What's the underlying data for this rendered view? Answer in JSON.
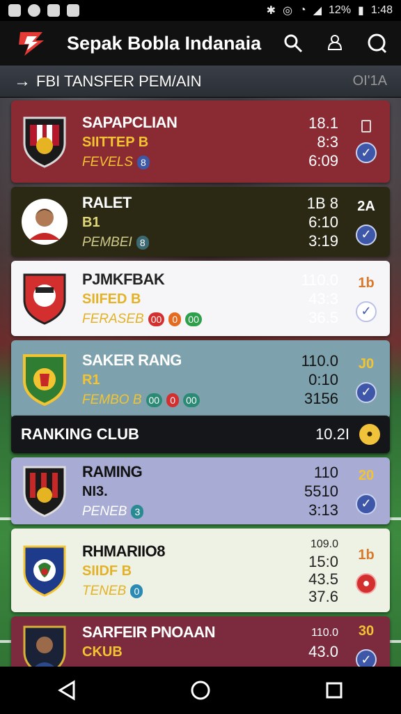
{
  "status": {
    "battery": "12%",
    "time": "1:48"
  },
  "app": {
    "title": "Sepak Bobla Indanaia"
  },
  "section": {
    "title": "FBI TANSFER PEM/AIN",
    "right": "OI'1A"
  },
  "cards": [
    {
      "name": "SAPAPCLIAN",
      "sub1": "SIITTEP B",
      "sub2": "FEVELS",
      "pills": [
        "8"
      ],
      "stats": [
        "18.1",
        "8:3",
        "6:09"
      ],
      "rank": "",
      "bg": "#8a2a33",
      "name_color": "#ffffff",
      "sub1_color": "#f3c431",
      "sub2_color": "#f3c431"
    },
    {
      "name": "RALET",
      "sub1": "B1",
      "sub2": "PEMBEI",
      "pills": [
        "8"
      ],
      "stats": [
        "1B 8",
        "6:10",
        "3:19"
      ],
      "rank": "2A",
      "bg": "#2b2913",
      "name_color": "#ffffff",
      "sub1_color": "#e0d779",
      "sub2_color": "#cfc98a"
    },
    {
      "name": "PJMKFBAK",
      "sub1": "SIIFED B",
      "sub2": "FERASEB",
      "pills": [
        "00",
        "0",
        "00"
      ],
      "stats": [
        "110.0",
        "43:3",
        "36.5"
      ],
      "rank": "1b",
      "bg": "#f6f6f8",
      "name_color": "#222222",
      "sub1_color": "#e3b227",
      "sub2_color": "#e3b227"
    },
    {
      "name": "SAKER RANG",
      "sub1": "R1",
      "sub2": "FEMBO B",
      "pills": [
        "00",
        "0",
        "00"
      ],
      "stats": [
        "110.0",
        "0:10",
        "3156"
      ],
      "rank": "J0",
      "bg": "#7ea2ad",
      "name_color": "#ffffff",
      "sub1_color": "#f3c431",
      "sub2_color": "#f3c431"
    }
  ],
  "ranking": {
    "title": "RANKING CLUB",
    "value": "10.2I"
  },
  "cards2": [
    {
      "name": "RAMING",
      "sub1": "NI3.",
      "sub2": "PENEB",
      "pills": [
        "3"
      ],
      "stats": [
        "110",
        "5510",
        "3:13"
      ],
      "rank": "20",
      "bg": "#a8acd4",
      "name_color": "#111111",
      "sub1_color": "#111111",
      "sub2_color": "#ffffff"
    },
    {
      "name": "RHMARIIO8",
      "sub1": "SIIDF B",
      "sub2": "TENEB",
      "pills": [
        "0"
      ],
      "stats": [
        "109.0",
        "15:0",
        "43.5",
        "37.6"
      ],
      "rank": "1b",
      "bg": "#eef2e4",
      "name_color": "#111111",
      "sub1_color": "#e3b227",
      "sub2_color": "#e3b227"
    },
    {
      "name": "SARFEIR PNOAAN",
      "sub1": "CKUB",
      "sub2": "",
      "pills": [],
      "stats": [
        "110.0",
        "43.0"
      ],
      "rank": "30",
      "bg": "#7b2b3d",
      "name_color": "#ffffff",
      "sub1_color": "#f3c431",
      "sub2_color": "#f3c431"
    }
  ]
}
